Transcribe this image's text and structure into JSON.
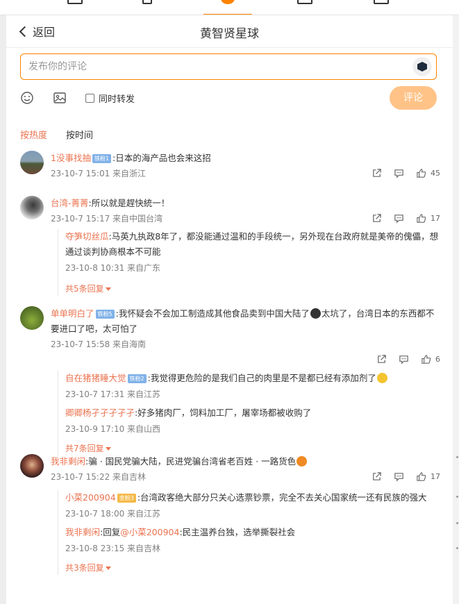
{
  "header": {
    "back_label": "返回",
    "title": "黄智贤星球"
  },
  "compose": {
    "placeholder": "发布你的评论",
    "repost_label": "同时转发",
    "submit_label": "评论"
  },
  "sort": {
    "hot": "按热度",
    "time": "按时间"
  },
  "colors": {
    "accent": "#ff8200",
    "username": "#eb7350",
    "submit_disabled": "#ffc388",
    "badge": "#81b2e8"
  },
  "icons": [
    "emoji-icon",
    "image-icon",
    "share-icon",
    "comment-icon",
    "like-icon",
    "ai-assistant-icon"
  ],
  "comments": [
    {
      "user": "1没事找抽",
      "badge": "铁粉1",
      "text": ":日本的海产品也会来这招",
      "meta": "23-10-7 15:01 来自浙江",
      "likes": "45",
      "replies": []
    },
    {
      "user": "台湾-菁菁",
      "badge": "",
      "text": ":所以就是趕快統一！",
      "meta": "23-10-7 15:17 来自中国台湾",
      "likes": "17",
      "replies": [
        {
          "user": "夺笋切丝瓜",
          "badge": "",
          "text": ":马英九执政8年了，都没能通过温和的手段统一，另外现在台政府就是美帝的傀儡，想通过谈判协商根本不可能",
          "meta": "23-10-8 10:31 来自广东"
        }
      ],
      "more": "共5条回复"
    },
    {
      "user": "单单明白了",
      "badge": "铁粉5",
      "text": ":我怀疑会不会加工制造成其他食品卖到中国大陆了",
      "text2": "太坑了，台湾日本的东西都不要进口了吧，太可怕了",
      "meta": "23-10-7 15:58 来自海南",
      "likes": "6",
      "replies": [
        {
          "user": "自在猪猪睡大觉",
          "badge": "铁粉2",
          "text": ":我觉得更危险的是我们自己的肉里是不是都已经有添加剂了",
          "meta": "23-10-7 17:31 来自江苏"
        },
        {
          "user": "卿卿杨孑孑孑孑孑",
          "badge": "",
          "text": ":好多猪肉厂，饲料加工厂，屠宰场都被收购了",
          "meta": "23-10-9 17:10 来自山西"
        }
      ],
      "more": "共7条回复"
    },
    {
      "user": "我非剩闲",
      "badge": "",
      "text": ":骗 · 国民党骗大陆，民进党骗台湾省老百姓 · 一路货色",
      "meta": "23-10-7 15:22 来自吉林",
      "likes": "17",
      "replies": [
        {
          "user": "小菜200904",
          "badge": "金粉3",
          "text": ":台湾政客绝大部分只关心选票钞票，完全不去关心国家统一还有民族的强大",
          "meta": "23-10-7 18:00 来自江苏"
        },
        {
          "user": "我非剩闲",
          "badge": "",
          "text_prefix": ":回复",
          "mention": "@小菜200904",
          "text": ":民主温养台独，选举撕裂社会",
          "meta": "23-10-8 23:15 来自吉林"
        }
      ],
      "more": "共3条回复"
    }
  ]
}
